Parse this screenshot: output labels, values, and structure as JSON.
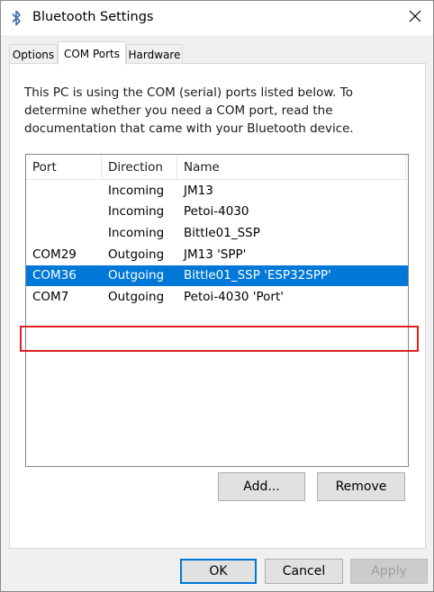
{
  "window": {
    "title": "Bluetooth Settings",
    "title_icon": "bluetooth-icon",
    "close_icon": "close-icon"
  },
  "tabs": [
    {
      "label": "Options",
      "active": false
    },
    {
      "label": "COM Ports",
      "active": true
    },
    {
      "label": "Hardware",
      "active": false
    }
  ],
  "description": "This PC is using the COM (serial) ports listed below. To determine whether you need a COM port, read the documentation that came with your Bluetooth device.",
  "table": {
    "columns": [
      "Port",
      "Direction",
      "Name"
    ],
    "rows": [
      {
        "port": "",
        "direction": "Incoming",
        "name": "JM13"
      },
      {
        "port": "",
        "direction": "Incoming",
        "name": "Petoi-4030"
      },
      {
        "port": "",
        "direction": "Incoming",
        "name": "Bittle01_SSP"
      },
      {
        "port": "COM29",
        "direction": "Outgoing",
        "name": "JM13 'SPP'"
      },
      {
        "port": "COM36",
        "direction": "Outgoing",
        "name": "Bittle01_SSP 'ESP32SPP'"
      },
      {
        "port": "COM7",
        "direction": "Outgoing",
        "name": "Petoi-4030 'Port'"
      }
    ],
    "selected_row": 4
  },
  "buttons": {
    "add": "Add...",
    "remove": "Remove",
    "ok": "OK",
    "cancel": "Cancel",
    "apply": "Apply"
  },
  "colors": {
    "selection": "#0078d7",
    "highlight_box": "#e02020"
  }
}
